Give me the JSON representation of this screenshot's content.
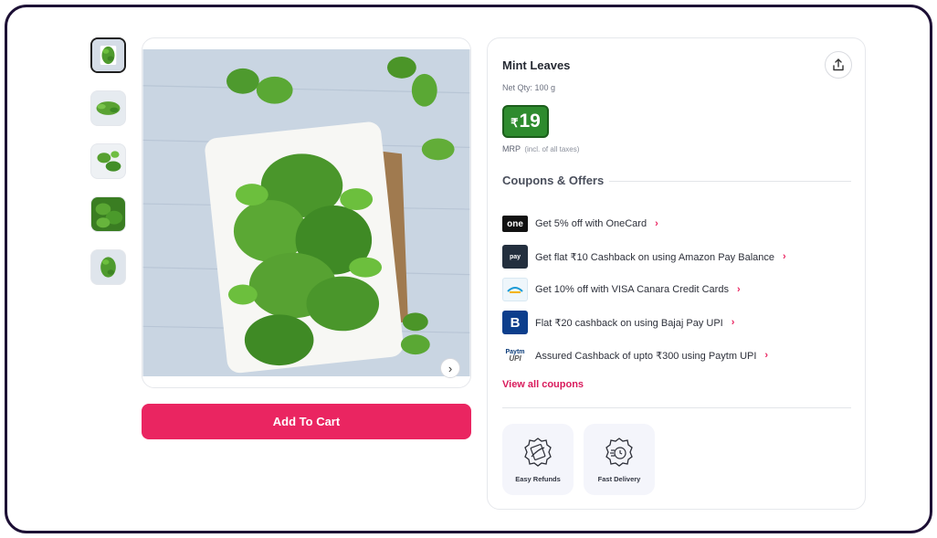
{
  "product": {
    "name": "Mint Leaves",
    "net_qty": "Net Qty: 100 g",
    "price_symbol": "₹",
    "price_value": "19",
    "mrp_label": "MRP",
    "mrp_note": "(incl. of all taxes)"
  },
  "gallery": {
    "thumbnail_count": 5,
    "active_index": 0,
    "next_icon": "chevron-right-icon"
  },
  "actions": {
    "add_to_cart": "Add To Cart",
    "share_icon": "share-icon"
  },
  "coupons": {
    "heading": "Coupons & Offers",
    "offers": [
      {
        "logo": "onecard-logo",
        "logo_text": "one",
        "text": "Get 5% off with OneCard"
      },
      {
        "logo": "amazon-pay-logo",
        "logo_text": "pay",
        "text": "Get flat ₹10 Cashback on using Amazon Pay Balance"
      },
      {
        "logo": "canara-bank-logo",
        "logo_text": "",
        "text": "Get 10% off with VISA Canara Credit Cards"
      },
      {
        "logo": "bajaj-finserv-logo",
        "logo_text": "B",
        "text": "Flat ₹20 cashback on using Bajaj Pay UPI"
      },
      {
        "logo": "paytm-upi-logo",
        "logo_text": "Paytm",
        "text": "Assured Cashback of upto ₹300 using Paytm UPI"
      }
    ],
    "view_all": "View all coupons"
  },
  "features": [
    {
      "icon": "refund-icon",
      "label": "Easy Refunds"
    },
    {
      "icon": "fast-delivery-icon",
      "label": "Fast Delivery"
    }
  ],
  "colors": {
    "accent": "#ea2561",
    "price_bg": "#2e8b2e",
    "frame_border": "#1d1035"
  }
}
